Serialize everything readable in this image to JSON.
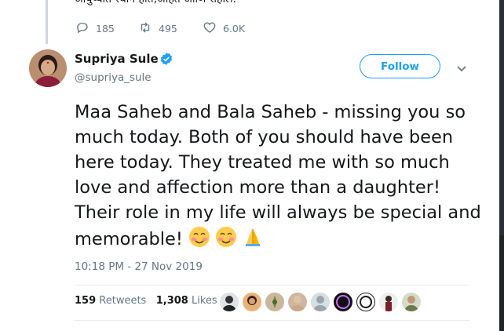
{
  "previous_tweet": {
    "text": "आयुष्यात स्थान होतं,आहेत आणि राहील.",
    "replies": "185",
    "retweets": "495",
    "likes": "6.0K"
  },
  "tweet": {
    "author_name": "Supriya Sule",
    "author_handle": "@supriya_sule",
    "verified": true,
    "follow_label": "Follow",
    "text": "Maa Saheb and Bala Saheb - missing you so much today. Both of you should have been here today. They treated me with so much love and affection more than a daughter! Their role in my life will always be special and memorable!",
    "emojis": [
      "smiling-face-icon",
      "smiling-face-icon",
      "folded-hands-icon"
    ],
    "timestamp": "10:18 PM - 27 Nov 2019",
    "retweet_count": "159",
    "retweet_label": "Retweets",
    "like_count": "1,308",
    "like_label": "Likes"
  },
  "colors": {
    "accent": "#1da1f2",
    "muted": "#657786",
    "text": "#14171a",
    "divider": "#e6ecf0"
  },
  "liker_avatars": [
    "liker-avatar",
    "liker-avatar",
    "liker-avatar",
    "liker-avatar",
    "liker-avatar",
    "liker-avatar",
    "liker-avatar",
    "liker-avatar",
    "liker-avatar"
  ]
}
